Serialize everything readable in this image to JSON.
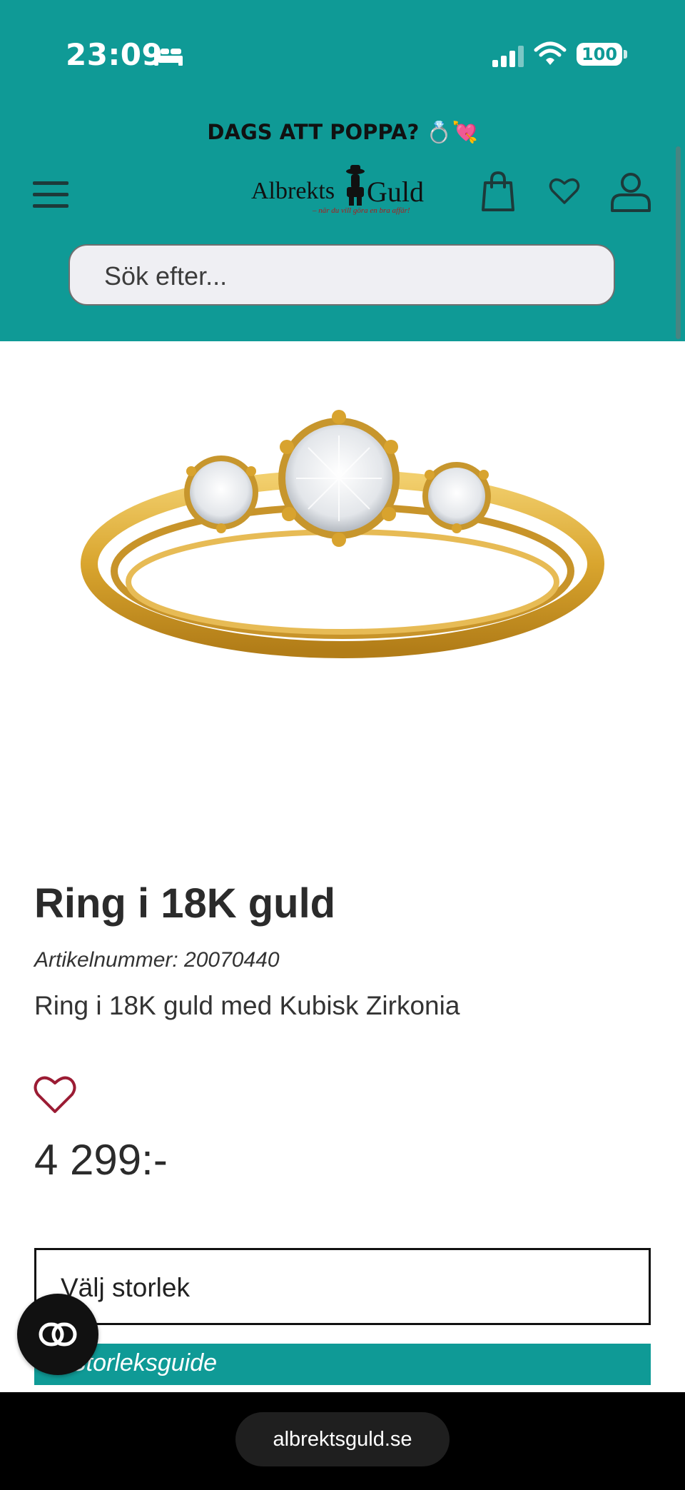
{
  "status_bar": {
    "time": "23:09",
    "battery": "100"
  },
  "header": {
    "promo": "DAGS ATT POPPA? 💍💘",
    "logo": {
      "name": "Albrekts Guld",
      "tagline": "– när du vill göra en bra affär!"
    },
    "search": {
      "placeholder": "Sök efter..."
    }
  },
  "product": {
    "title": "Ring i 18K guld",
    "sku": "Artikelnummer: 20070440",
    "description": "Ring i 18K guld med Kubisk Zirkonia",
    "price": "4 299:-",
    "size_select": "Välj storlek",
    "size_guide": "Storleksguide"
  },
  "browser": {
    "url": "albrektsguld.se"
  },
  "colors": {
    "header_bg": "#0f9a96",
    "accent_heart": "#9b1c34",
    "gold": "#d8a32e"
  },
  "icons": [
    "bed-icon",
    "signal-icon",
    "wifi-icon",
    "battery-icon",
    "menu-icon",
    "cart-icon",
    "heart-icon",
    "user-icon",
    "favorite-heart-icon",
    "chat-icon"
  ]
}
